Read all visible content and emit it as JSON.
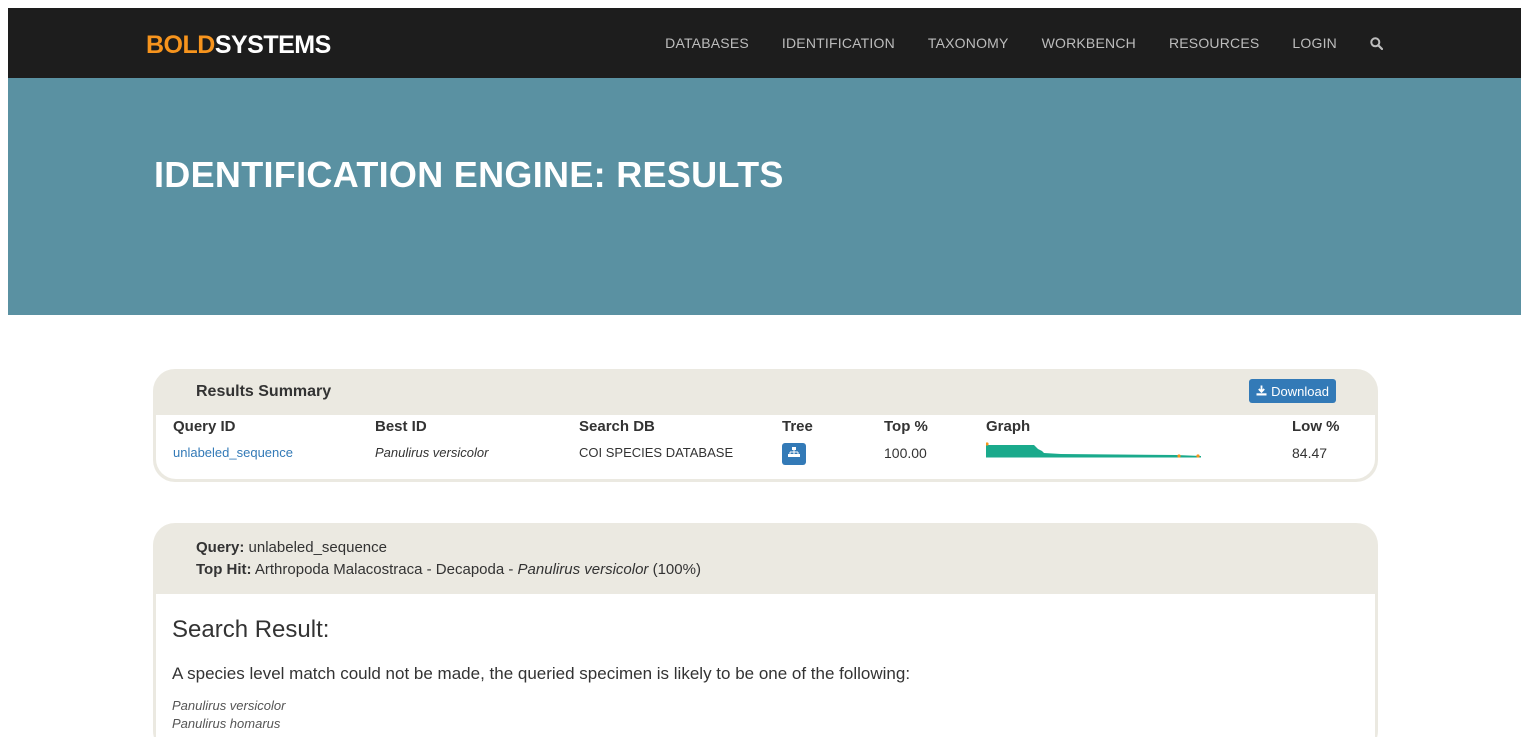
{
  "brand": {
    "part1": "BOLD",
    "part2": "SYSTEMS"
  },
  "nav": {
    "items": [
      "DATABASES",
      "IDENTIFICATION",
      "TAXONOMY",
      "WORKBENCH",
      "RESOURCES",
      "LOGIN"
    ],
    "search_icon": "search-icon"
  },
  "hero": {
    "title": "IDENTIFICATION ENGINE: RESULTS"
  },
  "summary": {
    "title": "Results Summary",
    "download_label": "Download",
    "columns": [
      "Query ID",
      "Best ID",
      "Search DB",
      "Tree",
      "Top %",
      "Graph",
      "Low %"
    ],
    "row": {
      "query_id": "unlabeled_sequence",
      "best_id": "Panulirus versicolor",
      "search_db": "COI SPECIES DATABASE",
      "top_pct": "100.00",
      "low_pct": "84.47"
    }
  },
  "query": {
    "query_label": "Query:",
    "query_value": "unlabeled_sequence",
    "tophit_label": "Top Hit:",
    "tophit_text": "Arthropoda Malacostraca - Decapoda - ",
    "tophit_species": "Panulirus versicolor",
    "tophit_pct": "(100%)",
    "result_title": "Search Result:",
    "result_text": "A species level match could not be made, the queried specimen is likely to be one of the following:",
    "species": [
      "Panulirus versicolor",
      "Panulirus homarus"
    ]
  },
  "colors": {
    "accent": "#f7941d",
    "navbar": "#1d1d1d",
    "hero": "#5a91a2",
    "link": "#337ab7",
    "graph_fill": "#1aaa8c"
  }
}
